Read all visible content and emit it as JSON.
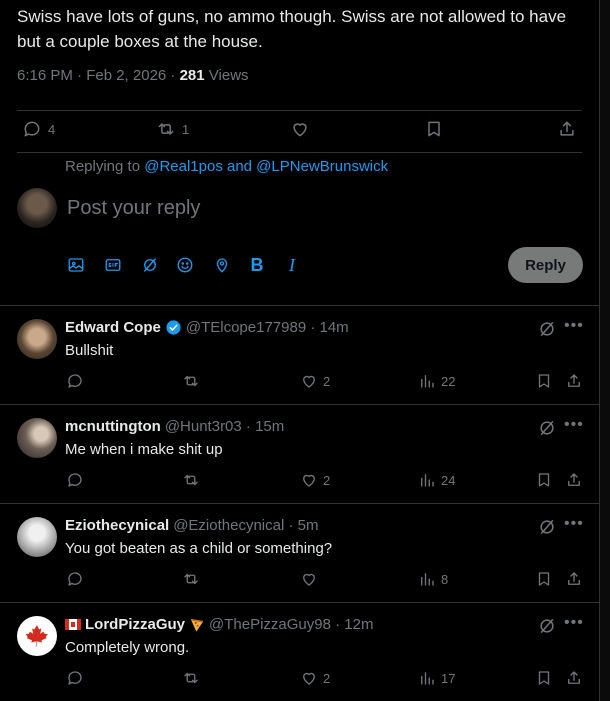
{
  "tweet": {
    "text": "Swiss have lots of guns, no ammo though. Swiss are not allowed to have but a couple boxes at the house.",
    "time": "6:16 PM · Feb 2, 2026 · ",
    "views_count": "281",
    "views_label": "Views",
    "replies": "4",
    "reposts": "1"
  },
  "composer": {
    "replying_prefix": "Replying to ",
    "replying_handles": "@Real1pos and @LPNewBrunswick",
    "placeholder": "Post your reply",
    "reply_button": "Reply"
  },
  "replies": [
    {
      "name": "Edward Cope",
      "verified": true,
      "handle": "@TElcope177989 · 14m",
      "text": "Bullshit",
      "comments": "",
      "reposts": "",
      "likes": "2",
      "views": "22"
    },
    {
      "name": "mcnuttington",
      "handle": "@Hunt3r03 · 15m",
      "text": "Me when i make shit up",
      "comments": "",
      "reposts": "",
      "likes": "2",
      "views": "24"
    },
    {
      "name": "Eziothecynical",
      "handle": "@Eziothecynical · 5m",
      "text": "You got beaten as a child or something?",
      "comments": "",
      "reposts": "",
      "likes": "",
      "views": "8"
    },
    {
      "name": "LordPizzaGuy",
      "handle": "@ThePizzaGuy98 · 12m",
      "text": "Completely wrong.",
      "comments": "",
      "reposts": "",
      "likes": "2",
      "views": "17"
    }
  ],
  "colors": {
    "accent": "#1d9bf0",
    "muted": "#71767b",
    "border": "#2f3336",
    "background": "#000000"
  }
}
